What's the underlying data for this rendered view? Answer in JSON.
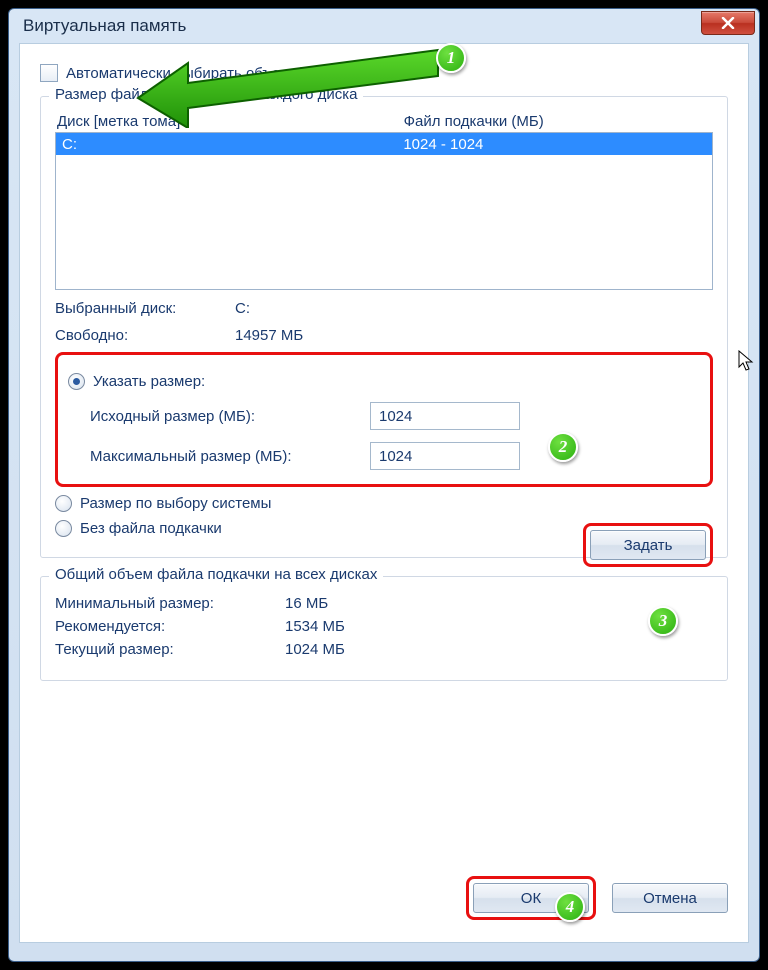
{
  "window": {
    "title": "Виртуальная память"
  },
  "auto_checkbox": {
    "label": "Автоматически выбирать объем файла подкачки",
    "checked": false
  },
  "size_group": {
    "legend": "Размер файла подкачки для каждого диска",
    "col1": "Диск [метка тома]",
    "col2": "Файл подкачки (МБ)",
    "rows": [
      {
        "drive": "C:",
        "pagefile": "1024 - 1024"
      }
    ],
    "selected_label": "Выбранный диск:",
    "selected_value": "C:",
    "free_label": "Свободно:",
    "free_value": "14957 МБ",
    "custom_radio": "Указать размер:",
    "initial_label": "Исходный размер (МБ):",
    "initial_value": "1024",
    "max_label": "Максимальный размер (МБ):",
    "max_value": "1024",
    "system_radio": "Размер по выбору системы",
    "none_radio": "Без файла подкачки",
    "set_button": "Задать"
  },
  "total_group": {
    "legend": "Общий объем файла подкачки на всех дисках",
    "min_label": "Минимальный размер:",
    "min_value": "16 МБ",
    "rec_label": "Рекомендуется:",
    "rec_value": "1534 МБ",
    "cur_label": "Текущий размер:",
    "cur_value": "1024 МБ"
  },
  "buttons": {
    "ok": "ОК",
    "cancel": "Отмена"
  },
  "callouts": {
    "n1": "1",
    "n2": "2",
    "n3": "3",
    "n4": "4"
  }
}
